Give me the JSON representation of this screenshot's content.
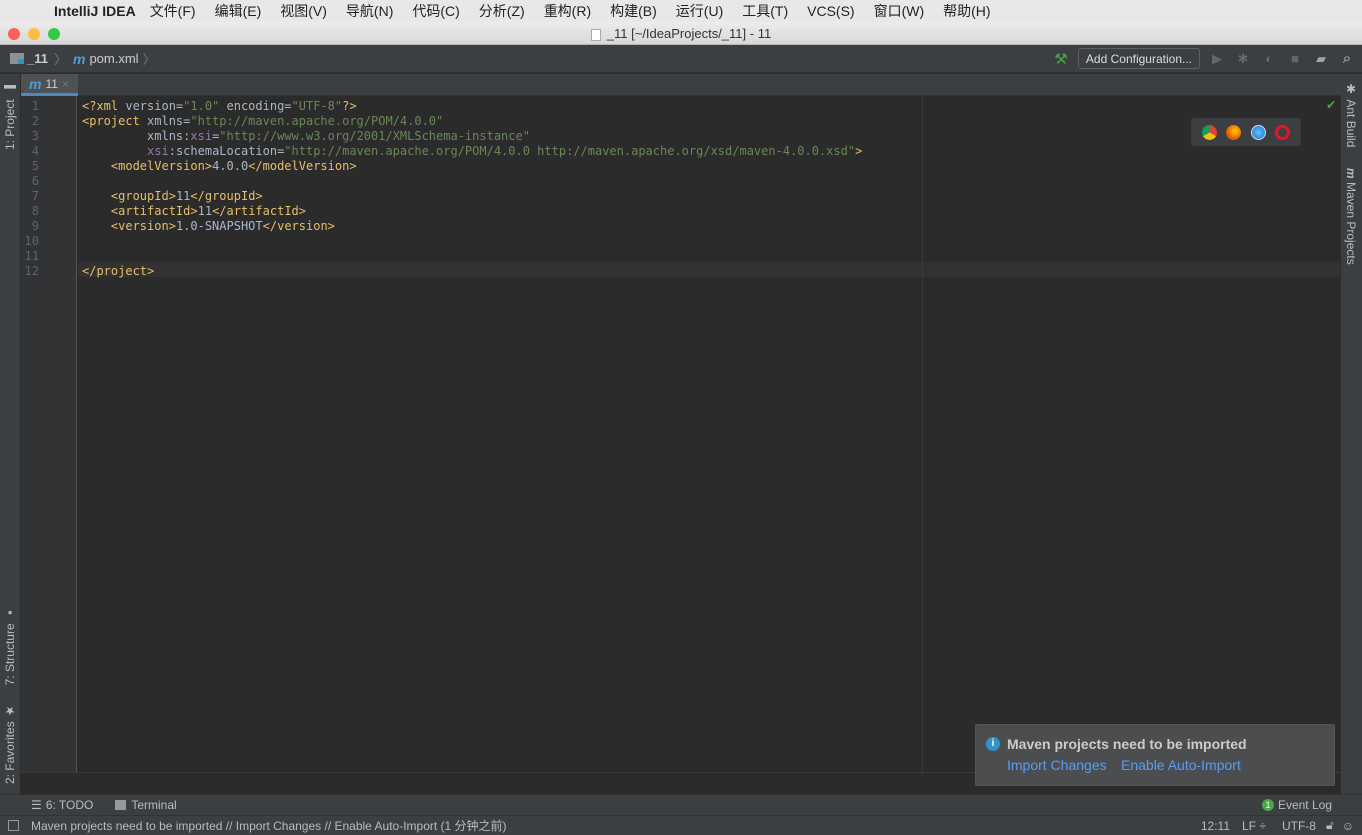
{
  "menubar": {
    "app_name": "IntelliJ IDEA",
    "items": [
      "文件(F)",
      "编辑(E)",
      "视图(V)",
      "导航(N)",
      "代码(C)",
      "分析(Z)",
      "重构(R)",
      "构建(B)",
      "运行(U)",
      "工具(T)",
      "VCS(S)",
      "窗口(W)",
      "帮助(H)"
    ]
  },
  "window": {
    "title": "_11 [~/IdeaProjects/_11] - 11"
  },
  "navbar": {
    "breadcrumbs": [
      "_11",
      "pom.xml"
    ],
    "add_configuration_label": "Add Configuration..."
  },
  "left_tools": {
    "project": "1: Project",
    "structure": "7: Structure",
    "favorites": "2: Favorites"
  },
  "right_tools": {
    "ant": "Ant Build",
    "maven": "Maven Projects"
  },
  "editor_tab": {
    "label": "11",
    "close": "×"
  },
  "editor": {
    "line_numbers": [
      "1",
      "2",
      "3",
      "4",
      "5",
      "6",
      "7",
      "8",
      "9",
      "10",
      "11",
      "12"
    ],
    "lines": [
      "<?xml version=\"1.0\" encoding=\"UTF-8\"?>",
      "<project xmlns=\"http://maven.apache.org/POM/4.0.0\"",
      "         xmlns:xsi=\"http://www.w3.org/2001/XMLSchema-instance\"",
      "         xsi:schemaLocation=\"http://maven.apache.org/POM/4.0.0 http://maven.apache.org/xsd/maven-4.0.0.xsd\">",
      "    <modelVersion>4.0.0</modelVersion>",
      "",
      "    <groupId>11</groupId>",
      "    <artifactId>11</artifactId>",
      "    <version>1.0-SNAPSHOT</version>",
      "",
      "",
      "</project>"
    ]
  },
  "browsers": [
    "chrome-icon",
    "firefox-icon",
    "safari-icon",
    "opera-icon"
  ],
  "notification": {
    "title": "Maven projects need to be imported",
    "link_import": "Import Changes",
    "link_auto": "Enable Auto-Import"
  },
  "bottom_tabs": {
    "todo": "6: TODO",
    "terminal": "Terminal",
    "event_log": "Event Log",
    "event_count": "1"
  },
  "status": {
    "message": "Maven projects need to be imported // Import Changes // Enable Auto-Import (1 分钟之前)",
    "position": "12:11",
    "line_sep": "LF ÷",
    "encoding": "UTF-8"
  }
}
